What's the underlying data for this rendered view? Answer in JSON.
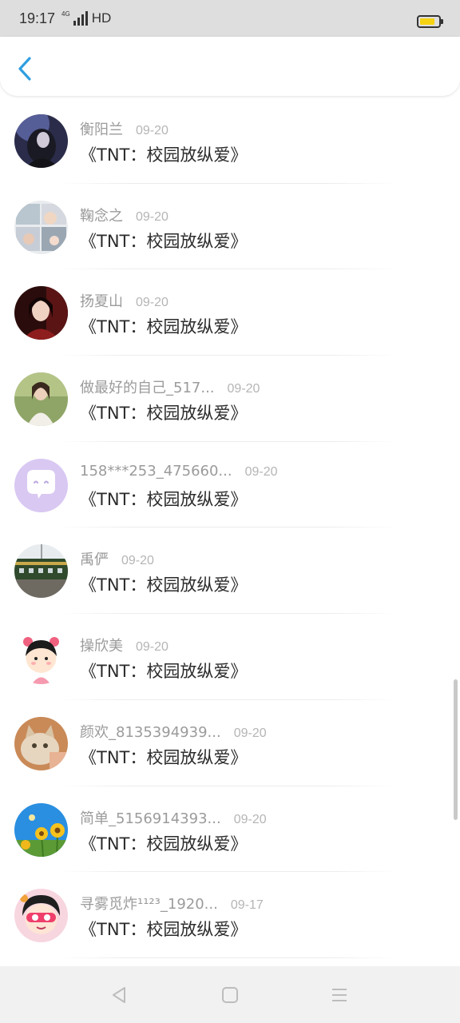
{
  "status_bar": {
    "time": "19:17",
    "network": "4G",
    "hd": "HD",
    "battery_level": 0.7,
    "battery_color": "#f5d313"
  },
  "header": {
    "back_icon": "chevron-left-icon",
    "accent_color": "#2f9fe0"
  },
  "items": [
    {
      "user": "衡阳兰",
      "date": "09-20",
      "title": "《TNT：校园放纵爱》",
      "avatar": "dark-portrait-avatar"
    },
    {
      "user": "鞠念之",
      "date": "09-20",
      "title": "《TNT：校园放纵爱》",
      "avatar": "photo-collage-avatar"
    },
    {
      "user": "扬夏山",
      "date": "09-20",
      "title": "《TNT：校园放纵爱》",
      "avatar": "red-portrait-avatar"
    },
    {
      "user": "做最好的自己_517...",
      "date": "09-20",
      "title": "《TNT：校园放纵爱》",
      "avatar": "outdoor-girl-avatar"
    },
    {
      "user": "158***253_475660...",
      "date": "09-20",
      "title": "《TNT：校园放纵爱》",
      "avatar": "chat-bubble-avatar"
    },
    {
      "user": "禹俨",
      "date": "09-20",
      "title": "《TNT：校园放纵爱》",
      "avatar": "train-avatar"
    },
    {
      "user": "操欣美",
      "date": "09-20",
      "title": "《TNT：校园放纵爱》",
      "avatar": "cartoon-girl-avatar"
    },
    {
      "user": "颜欢_8135394939...",
      "date": "09-20",
      "title": "《TNT：校园放纵爱》",
      "avatar": "cat-avatar"
    },
    {
      "user": "简单_5156914393...",
      "date": "09-20",
      "title": "《TNT：校园放纵爱》",
      "avatar": "sunflower-avatar"
    },
    {
      "user": "寻雾觅炸¹¹²³_1920...",
      "date": "09-17",
      "title": "《TNT：校园放纵爱》",
      "avatar": "pink-cartoon-avatar"
    }
  ],
  "nav_bar": {
    "back": "triangle-back-icon",
    "home": "square-home-icon",
    "menu": "menu-lines-icon"
  }
}
